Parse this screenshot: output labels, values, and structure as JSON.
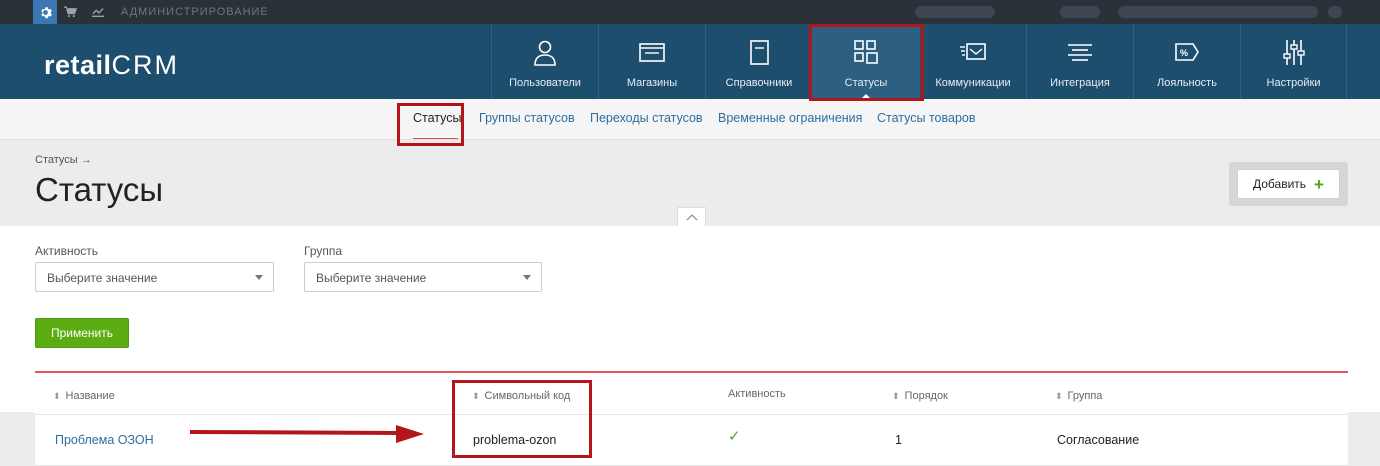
{
  "topbar": {
    "admin_label": "АДМИНИСТРИРОВАНИЕ",
    "icons": [
      "gear-icon",
      "cart-icon",
      "chart-icon"
    ]
  },
  "logo": {
    "text_a": "retail",
    "text_b": "CRM"
  },
  "nav": {
    "items": [
      {
        "label": "Пользователи",
        "icon": "user-icon"
      },
      {
        "label": "Магазины",
        "icon": "shop-icon"
      },
      {
        "label": "Справочники",
        "icon": "book-icon"
      },
      {
        "label": "Статусы",
        "icon": "status-grid-icon",
        "active": true
      },
      {
        "label": "Коммуникации",
        "icon": "mail-icon"
      },
      {
        "label": "Интеграция",
        "icon": "integration-icon"
      },
      {
        "label": "Лояльность",
        "icon": "percent-tag-icon"
      },
      {
        "label": "Настройки",
        "icon": "sliders-icon"
      }
    ]
  },
  "subnav": {
    "items": [
      {
        "label": "Статусы",
        "active": true
      },
      {
        "label": "Группы статусов"
      },
      {
        "label": "Переходы статусов"
      },
      {
        "label": "Временные ограничения"
      },
      {
        "label": "Статусы товаров"
      }
    ]
  },
  "header": {
    "breadcrumb": "Статусы →",
    "title": "Статусы",
    "add_label": "Добавить",
    "add_icon": "+"
  },
  "filters": {
    "activity_label": "Активность",
    "activity_placeholder": "Выберите значение",
    "group_label": "Группа",
    "group_placeholder": "Выберите значение",
    "apply_label": "Применить"
  },
  "table": {
    "columns": [
      "Название",
      "Символьный код",
      "Активность",
      "Порядок",
      "Группа"
    ],
    "rows": [
      {
        "name": "Проблема ОЗОН",
        "code": "problema-ozon",
        "active": "✓",
        "order": "1",
        "group": "Согласование"
      }
    ]
  },
  "colors": {
    "nav_bg": "#1e4e6e",
    "highlight": "#b3161a",
    "apply_green": "#5cad14",
    "link": "#2c6ea2"
  }
}
